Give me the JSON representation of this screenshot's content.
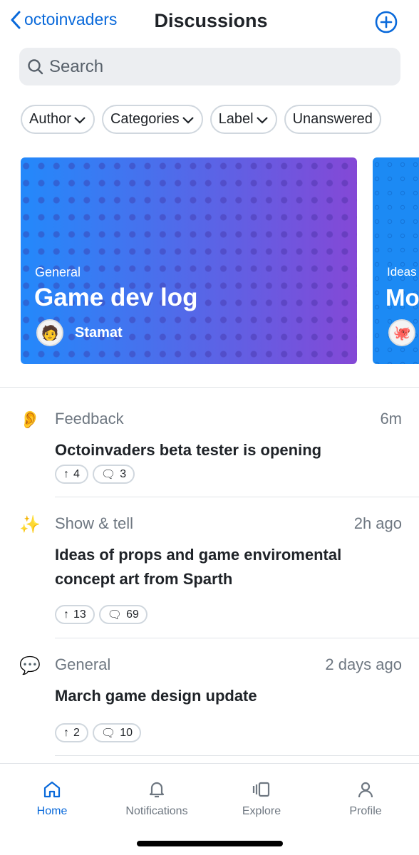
{
  "nav": {
    "back_label": "octoinvaders",
    "title": "Discussions",
    "add_icon": "plus-circle-icon"
  },
  "search": {
    "placeholder": "Search"
  },
  "filters": [
    {
      "label": "Author",
      "dropdown": true
    },
    {
      "label": "Categories",
      "dropdown": true
    },
    {
      "label": "Label",
      "dropdown": true
    },
    {
      "label": "Unanswered",
      "dropdown": false
    }
  ],
  "featured": [
    {
      "category": "General",
      "title": "Game dev log",
      "author": "Stamat",
      "colors": [
        "#2389fb",
        "#8448d6"
      ]
    },
    {
      "category": "Ideas",
      "title": "Mo",
      "author": ""
    }
  ],
  "discussions": [
    {
      "emoji": "👂",
      "category": "Feedback",
      "time": "6m",
      "title": "Octoinvaders beta tester is opening",
      "upvotes": "4",
      "comments": "3"
    },
    {
      "emoji": "✨",
      "category": "Show & tell",
      "time": "2h ago",
      "title": "Ideas of props and game enviromental concept art from Sparth",
      "upvotes": "13",
      "comments": "69"
    },
    {
      "emoji": "💬",
      "category": "General",
      "time": "2 days ago",
      "title": "March game design update",
      "upvotes": "2",
      "comments": "10"
    }
  ],
  "tabs": [
    {
      "label": "Home",
      "icon": "home-icon",
      "active": true
    },
    {
      "label": "Notifications",
      "icon": "bell-icon"
    },
    {
      "label": "Explore",
      "icon": "explore-icon"
    },
    {
      "label": "Profile",
      "icon": "person-icon"
    }
  ],
  "accent": "#0969da"
}
